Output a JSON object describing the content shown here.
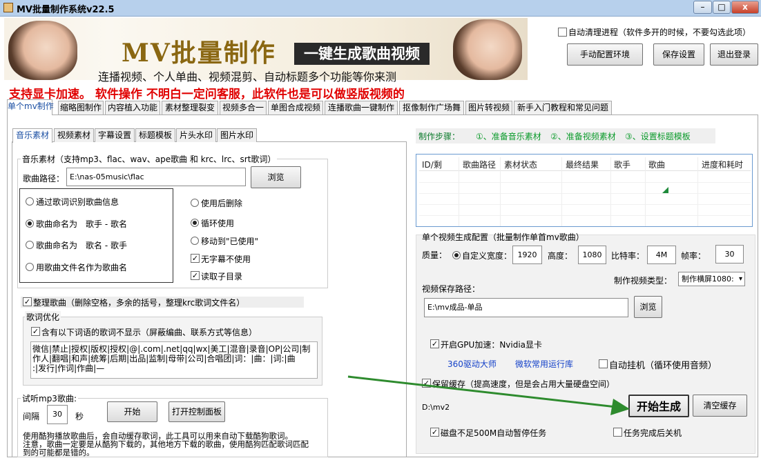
{
  "window": {
    "title": "MV批量制作系统v22.5",
    "minimize": "–",
    "maximize": "□",
    "close": "x"
  },
  "banner": {
    "title": "MV批量制作",
    "subtitle_box": "一键生成歌曲视频",
    "tagline": "连播视频、个人单曲、视频混剪、自动标题多个功能等你来测"
  },
  "header_options": {
    "auto_clean": "自动清理进程（软件多开的时候，不要勾选此项）",
    "manual_config": "手动配置环境",
    "save_settings": "保存设置",
    "logout": "退出登录"
  },
  "notice": "支持显卡加速。 软件操作 不明白一定问客服，此软件也是可以做竖版视频的",
  "main_tabs": [
    "单个mv制作",
    "缩略图制作",
    "内容植入功能",
    "素材整理裂变",
    "视频多合一",
    "单图合成视频",
    "连播歌曲一键制作",
    "抠像制作广场舞",
    "图片转视频",
    "新手入门教程和常见问题"
  ],
  "sub_tabs": [
    "音乐素材",
    "视频素材",
    "字幕设置",
    "标题模板",
    "片头水印",
    "图片水印"
  ],
  "music": {
    "group_label": "音乐素材（支持mp3、flac、wav、ape歌曲 和 krc、lrc、srt歌词）",
    "path_label": "歌曲路径：",
    "path_value": "E:\\nas-05music\\flac",
    "browse": "浏览",
    "name_options": [
      "通过歌词识别歌曲信息",
      "歌曲命名为　歌手 - 歌名",
      "歌曲命名为　歌名 - 歌手",
      "用歌曲文件名作为歌曲名"
    ],
    "after_options": [
      "使用后删除",
      "循环使用",
      "移动到\"已使用\""
    ],
    "no_subtitle": "无字幕不使用",
    "read_subdir": "读取子目录",
    "tidy": "整理歌曲（删除空格，多余的括号，整理krc歌词文件名）",
    "lyric_group": "歌词优化",
    "lyric_filter": "含有以下词语的歌词不显示（屏蔽编曲、联系方式等信息）",
    "lyric_words_line1": "微信|禁止|授权|版权|授权|@|.com|.net|qq|wx|美工|混音|录音|OP|公司|制",
    "lyric_words_line2": "作人|翻唱|和声|统筹|后期|出品|监制|母带|公司|合唱团|词：|曲：|词:|曲",
    "lyric_words_line3": ":|发行|作词|作曲|—",
    "preview_group": "试听mp3歌曲:",
    "interval_label": "间隔",
    "interval_value": "30",
    "seconds": "秒",
    "start": "开始",
    "open_panel": "打开控制面板",
    "info_line1": "使用酷狗播放歌曲后，会自动缓存歌词，此工具可以用来自动下载酷狗歌词。",
    "info_line2": "注意，歌曲一定要是从酷狗下载的，其他地方下载的歌曲，使用酷狗匹配歌词匹配",
    "info_line3": "到的可能都是错的。"
  },
  "steps": {
    "label": "制作步骤：",
    "step1": "①、准备音乐素材",
    "step2": "②、准备视频素材",
    "step3": "③、设置标题模板"
  },
  "table": {
    "columns": [
      "ID/剩",
      "歌曲路径",
      "素材状态",
      "最终结果",
      "歌手",
      "歌曲",
      "进度和耗时"
    ]
  },
  "config": {
    "group_label": "单个视频生成配置（批量制作单首mv歌曲）",
    "quality": "质量：",
    "custom_width": "自定义宽度：",
    "width": "1920",
    "height_label": "高度：",
    "height": "1080",
    "bitrate_label": "比特率：",
    "bitrate": "4M",
    "fps_label": "帧率：",
    "fps": "30",
    "type_label": "制作视频类型：",
    "type_value": "制作横屏1080:",
    "save_path_label": "视频保存路径：",
    "save_path": "E:\\mv成品-单品",
    "browse": "浏览",
    "gpu": "开启GPU加速：Nvidia显卡",
    "driver_link": "360驱动大师",
    "runtime_link": "微软常用运行库",
    "auto_hang": "自动挂机（循环使用音频）",
    "keep_cache": "保留缓存（提高速度，但是会占用大量硬盘空间）",
    "cache_path": "D:\\mv2",
    "start_generate": "开始生成",
    "clear_cache": "清空缓存",
    "disk_pause": "磁盘不足500M自动暂停任务",
    "shutdown": "任务完成后关机"
  }
}
